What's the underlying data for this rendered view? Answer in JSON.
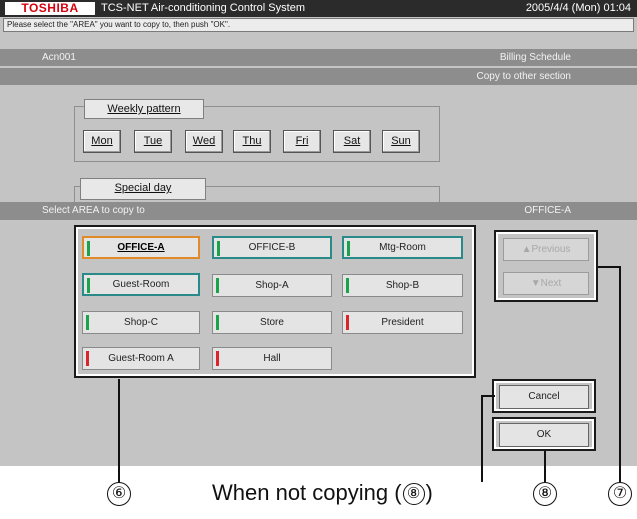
{
  "header": {
    "brand": "TOSHIBA",
    "app_title": "TCS-NET Air-conditioning Control System",
    "datetime": "2005/4/4 (Mon) 01:04"
  },
  "message": "Please select the \"AREA\" you want to copy to, then push \"OK\".",
  "section_bar": {
    "left": "Acn001",
    "right": "Billing Schedule"
  },
  "subtitle_bar": {
    "right": "Copy to other section"
  },
  "weekly": {
    "title": "Weekly pattern",
    "days": [
      "Mon",
      "Tue",
      "Wed",
      "Thu",
      "Fri",
      "Sat",
      "Sun"
    ]
  },
  "special_day": {
    "title": "Special day"
  },
  "area_bar": {
    "left": "Select AREA to copy to",
    "right": "OFFICE-A"
  },
  "areas": [
    {
      "label": "OFFICE-A",
      "stripe": "#1aa34a"
    },
    {
      "label": "OFFICE-B",
      "stripe": "#1aa34a"
    },
    {
      "label": "Mtg-Room",
      "stripe": "#1aa34a"
    },
    {
      "label": "Guest-Room",
      "stripe": "#1aa34a"
    },
    {
      "label": "Shop-A",
      "stripe": "#1aa34a"
    },
    {
      "label": "Shop-B",
      "stripe": "#1aa34a"
    },
    {
      "label": "Shop-C",
      "stripe": "#1aa34a"
    },
    {
      "label": "Store",
      "stripe": "#1aa34a"
    },
    {
      "label": "President",
      "stripe": "#d8262c"
    },
    {
      "label": "Guest-Room A",
      "stripe": "#d8262c"
    },
    {
      "label": "Hall",
      "stripe": "#d8262c"
    }
  ],
  "nav": {
    "previous": {
      "icon": "up-triangle-icon",
      "glyph": "▲",
      "label": "Previous"
    },
    "next": {
      "icon": "down-triangle-icon",
      "glyph": "▼",
      "label": "Next"
    }
  },
  "actions": {
    "cancel": "Cancel",
    "ok": "OK"
  },
  "callouts": {
    "six": "⑥",
    "seven": "⑦",
    "eight": "⑧",
    "eight_inline": "⑧"
  },
  "caption": {
    "before": "When not copying (",
    "after": ")"
  },
  "colors": {
    "brand_red": "#d7000f",
    "selected_orange": "#e08a2a",
    "selected_teal": "#2a8a8a",
    "status_green": "#1aa34a",
    "status_red": "#d8262c"
  }
}
